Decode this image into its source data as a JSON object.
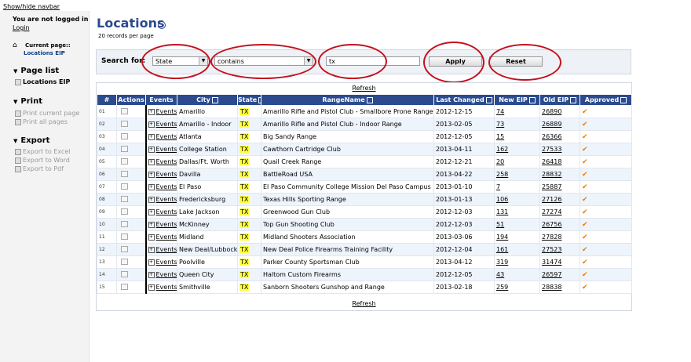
{
  "navbar": {
    "toggle_label": "Show/hide navbar",
    "login_status": "You are not logged in",
    "login_link": "Login",
    "current_page_label": "Current page::",
    "current_page_value": "Locations EIP",
    "sections": {
      "page_list": {
        "title": "Page list",
        "items": [
          "Locations EIP"
        ]
      },
      "print": {
        "title": "Print",
        "items": [
          "Print current page",
          "Print all pages"
        ]
      },
      "export": {
        "title": "Export",
        "items": [
          "Export to Excel",
          "Export to Word",
          "Export to Pdf"
        ]
      }
    }
  },
  "main": {
    "title": "Locations",
    "records_per_page": "20 records per page",
    "search": {
      "label": "Search for:",
      "field_value": "State",
      "operator_value": "contains",
      "input_value": "tx",
      "apply_label": "Apply",
      "reset_label": "Reset"
    },
    "refresh_label": "Refresh",
    "table": {
      "columns": [
        "#",
        "Actions",
        "Events",
        "City",
        "State",
        "RangeName",
        "Last Changed",
        "New EIP",
        "Old EIP",
        "Approved"
      ],
      "rows": [
        {
          "n": "01",
          "events": "Events",
          "city": "Amarillo",
          "state": "TX",
          "range": "Amarillo Rifle and Pistol Club - Smallbore Prone Range",
          "changed": "2012-12-15",
          "new": "74",
          "old": "26890"
        },
        {
          "n": "02",
          "events": "Events",
          "city": "Amarillo - Indoor",
          "state": "TX",
          "range": "Amarillo Rifle and Pistol Club - Indoor Range",
          "changed": "2013-02-05",
          "new": "73",
          "old": "26889"
        },
        {
          "n": "03",
          "events": "Events",
          "city": "Atlanta",
          "state": "TX",
          "range": "Big Sandy Range",
          "changed": "2012-12-05",
          "new": "15",
          "old": "26366"
        },
        {
          "n": "04",
          "events": "Events",
          "city": "College Station",
          "state": "TX",
          "range": "Cawthorn Cartridge Club",
          "changed": "2013-04-11",
          "new": "162",
          "old": "27533"
        },
        {
          "n": "05",
          "events": "Events",
          "city": "Dallas/Ft. Worth",
          "state": "TX",
          "range": "Quail Creek Range",
          "changed": "2012-12-21",
          "new": "20",
          "old": "26418"
        },
        {
          "n": "06",
          "events": "Events",
          "city": "Davilla",
          "state": "TX",
          "range": "BattleRoad USA",
          "changed": "2013-04-22",
          "new": "258",
          "old": "28832"
        },
        {
          "n": "07",
          "events": "Events",
          "city": "El Paso",
          "state": "TX",
          "range": "El Paso Community College Mission Del Paso Campus",
          "changed": "2013-01-10",
          "new": "7",
          "old": "25887"
        },
        {
          "n": "08",
          "events": "Events",
          "city": "Fredericksburg",
          "state": "TX",
          "range": "Texas Hills Sporting Range",
          "changed": "2013-01-13",
          "new": "106",
          "old": "27126"
        },
        {
          "n": "09",
          "events": "Events",
          "city": "Lake Jackson",
          "state": "TX",
          "range": "Greenwood Gun Club",
          "changed": "2012-12-03",
          "new": "131",
          "old": "27274"
        },
        {
          "n": "10",
          "events": "Events",
          "city": "McKinney",
          "state": "TX",
          "range": "Top Gun Shooting Club",
          "changed": "2012-12-03",
          "new": "51",
          "old": "26756"
        },
        {
          "n": "11",
          "events": "Events",
          "city": "Midland",
          "state": "TX",
          "range": "Midland Shooters Association",
          "changed": "2013-03-06",
          "new": "194",
          "old": "27828"
        },
        {
          "n": "12",
          "events": "Events",
          "city": "New Deal/Lubbock",
          "state": "TX",
          "range": "New Deal Police Firearms Training Facility",
          "changed": "2012-12-04",
          "new": "161",
          "old": "27523"
        },
        {
          "n": "13",
          "events": "Events",
          "city": "Poolville",
          "state": "TX",
          "range": "Parker County Sportsman Club",
          "changed": "2013-04-12",
          "new": "319",
          "old": "31474"
        },
        {
          "n": "14",
          "events": "Events",
          "city": "Queen City",
          "state": "TX",
          "range": "Haltom Custom Firearms",
          "changed": "2012-12-05",
          "new": "43",
          "old": "26597"
        },
        {
          "n": "15",
          "events": "Events",
          "city": "Smithville",
          "state": "TX",
          "range": "Sanborn Shooters Gunshop and Range",
          "changed": "2013-02-18",
          "new": "259",
          "old": "28838"
        }
      ]
    }
  },
  "icons": {
    "home": "house-icon",
    "section_bullet": "triangle-down-icon",
    "sort": "sort-icon",
    "expand": "plus-icon",
    "approved": "checkmark-icon"
  },
  "colors": {
    "header_bg": "#2b4b8e",
    "title": "#2c4a8e",
    "state_highlight": "#ffff40",
    "approved_check": "#f07c00",
    "annotation": "#c4101d"
  }
}
